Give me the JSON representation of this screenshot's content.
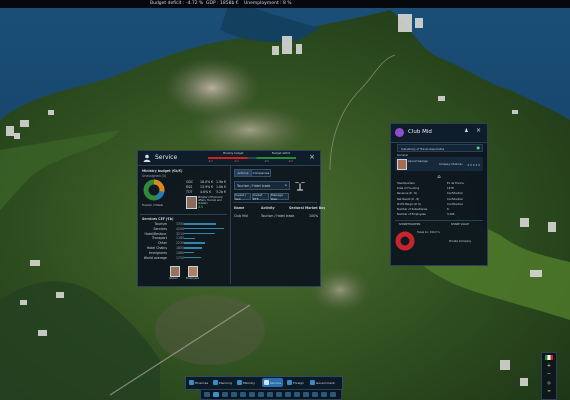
{
  "topbar": {
    "budget": "Budget deficit : -4.72 %",
    "gdp": "GDP : 1858b €",
    "unemployment": "Unemployment : 8 %"
  },
  "service_panel": {
    "title": "Service",
    "gauge_left_label": "Ministry budget",
    "gauge_right_label": "Budget deficit",
    "gauge_values": [
      "-4.7",
      "-0.1",
      "-0.5",
      "-0.3"
    ],
    "ministry_budget_title": "Ministry budget (€b/€)",
    "ministry_budget_subtitle": "Unassigned (0)",
    "budget_rows": [
      {
        "label": "GDC",
        "a": "18.0% €",
        "b": "1.9b €"
      },
      {
        "label": "RSS",
        "a": "13.9% €",
        "b": "1.0b €"
      },
      {
        "label": "TOT",
        "a": "4.6% €",
        "b": "3.2b €"
      }
    ],
    "donut_caption": "Tourism / Hotels",
    "minister_caption": "Minister of Economic affairs, Tourism and Industry",
    "minister_value": "4.5",
    "services_title": "Services CEF (€b)",
    "services": [
      {
        "name": "Tourism",
        "value": "3350"
      },
      {
        "name": "Services",
        "value": "4200"
      },
      {
        "name": "Hotel/Restaur.",
        "value": "3210"
      },
      {
        "name": "Transport",
        "value": "1180"
      },
      {
        "name": "Other",
        "value": "2230"
      },
      {
        "name": "Hotel Chains",
        "value": "1850"
      },
      {
        "name": "Immigrants",
        "value": "1060"
      },
      {
        "name": "World average",
        "value": "1750"
      }
    ],
    "advisors": [
      "Advisor",
      "Employees"
    ],
    "tabs": [
      "Actions",
      "Companies"
    ],
    "selector_label": "Tourism / Hotel trade",
    "filter_buttons": [
      "Invest / Sell",
      "Invest ETF",
      "Manage Risk"
    ],
    "table_headers": [
      "Name",
      "Activity",
      "Sectoral Market Bay"
    ],
    "table_rows": [
      {
        "name": "Club Mid",
        "activity": "Tourism / Hotel trade",
        "value": "100%"
      }
    ]
  },
  "club_panel": {
    "title": "Club Mid",
    "subtitle": "Subsidiary of Travel Associates",
    "section_label": "General",
    "person_name": "Laurel George",
    "person_role": "Company Chairman",
    "details": [
      {
        "label": "Headquarters",
        "value": "Ex de France"
      },
      {
        "label": "Date of Founding",
        "value": "1978"
      },
      {
        "label": "Revenue (€ - €)",
        "value": "Confidential"
      },
      {
        "label": "Net Result (€ - €)",
        "value": "Confidential"
      },
      {
        "label": "Profit Margin (€ %)",
        "value": "Confidential"
      },
      {
        "label": "Number of Subsidiaries",
        "value": "8"
      },
      {
        "label": "Number of Employees",
        "value": "3,290"
      }
    ],
    "shareholders_title": "SHAREHOLDERS",
    "sharehold_caption": "Travel Inc. 100.0 %",
    "value_title": "SHARE VALUE",
    "value_caption": "Private Company"
  },
  "bottom_tabs": [
    "Finances",
    "Planning",
    "Ministry",
    "Service",
    "Foreign",
    "Government"
  ],
  "colors": {
    "accent": "#2a6fb0",
    "donut_red": "#c8242b",
    "club_purple": "#8e4fc8",
    "bar_cyan": "#2f86a8"
  }
}
